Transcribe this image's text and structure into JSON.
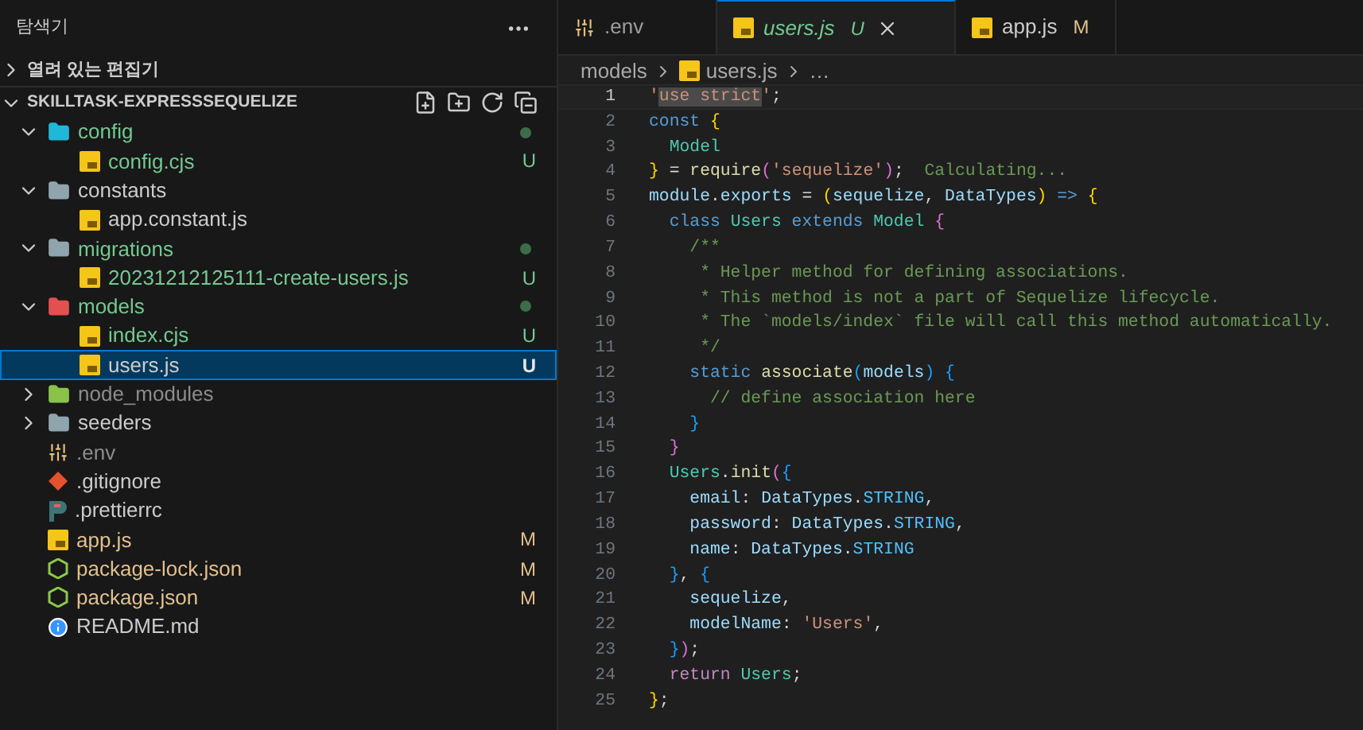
{
  "explorer": {
    "title": "탐색기",
    "open_editors": {
      "label": "열려 있는 편집기",
      "expanded": false
    },
    "project": {
      "label": "SKILLTASK-EXPRESSSEQUELIZE",
      "expanded": true
    },
    "tree": [
      {
        "name": "config",
        "kind": "folder-config",
        "expanded": true,
        "color": "#73c991",
        "dot": true,
        "children": [
          {
            "name": "config.cjs",
            "kind": "js",
            "color": "#73c991",
            "badge": "U",
            "selected": false
          }
        ]
      },
      {
        "name": "constants",
        "kind": "folder",
        "expanded": true,
        "children": [
          {
            "name": "app.constant.js",
            "kind": "js",
            "selected": false
          }
        ]
      },
      {
        "name": "migrations",
        "kind": "folder",
        "expanded": true,
        "color": "#73c991",
        "dot": true,
        "children": [
          {
            "name": "20231212125111-create-users.js",
            "kind": "js",
            "color": "#73c991",
            "badge": "U",
            "selected": false
          }
        ]
      },
      {
        "name": "models",
        "kind": "folder-models",
        "expanded": true,
        "color": "#73c991",
        "dot": true,
        "children": [
          {
            "name": "index.cjs",
            "kind": "js",
            "color": "#73c991",
            "badge": "U",
            "selected": false
          },
          {
            "name": "users.js",
            "kind": "js",
            "badge": "U",
            "selected": true
          }
        ]
      },
      {
        "name": "node_modules",
        "kind": "folder-node",
        "expanded": false,
        "color": "#8c8c8c"
      },
      {
        "name": "seeders",
        "kind": "folder",
        "expanded": false
      },
      {
        "name": ".env",
        "kind": "env",
        "color": "#8c8c8c",
        "selected": false
      },
      {
        "name": ".gitignore",
        "kind": "git",
        "selected": false
      },
      {
        "name": ".prettierrc",
        "kind": "prettier",
        "selected": false
      },
      {
        "name": "app.js",
        "kind": "js",
        "color": "#e2c08d",
        "badge": "M",
        "selected": false
      },
      {
        "name": "package-lock.json",
        "kind": "npm",
        "color": "#e2c08d",
        "badge": "M",
        "selected": false
      },
      {
        "name": "package.json",
        "kind": "npm",
        "color": "#e2c08d",
        "badge": "M",
        "selected": false
      },
      {
        "name": "README.md",
        "kind": "info",
        "selected": false
      }
    ]
  },
  "tabs": [
    {
      "label": ".env",
      "kind": "env",
      "selected": false,
      "color": "#9d9d9d"
    },
    {
      "label": "users.js",
      "kind": "js",
      "selected": true,
      "color": "#73c991",
      "badge": "U"
    },
    {
      "label": "app.js",
      "kind": "js",
      "selected": false,
      "color": "#e2c08d",
      "badge": "M"
    }
  ],
  "breadcrumb": [
    {
      "label": "models",
      "kind": "folder"
    },
    {
      "label": "users.js",
      "kind": "js"
    },
    {
      "label": "…",
      "kind": "more"
    }
  ],
  "code": [
    {
      "number": "1",
      "current": true,
      "tokens": [
        {
          "kind": "s",
          "text": "'"
        },
        {
          "kind": "sh",
          "text": "use strict"
        },
        {
          "kind": "s",
          "text": "'"
        },
        {
          "kind": "p",
          "text": ";"
        }
      ]
    },
    {
      "number": "2",
      "current": false,
      "tokens": [
        {
          "kind": "k",
          "text": "const "
        },
        {
          "kind": "b1",
          "text": "{"
        }
      ]
    },
    {
      "number": "3",
      "current": false,
      "tokens": [
        {
          "kind": "t",
          "text": "  Model"
        }
      ]
    },
    {
      "number": "4",
      "current": false,
      "tokens": [
        {
          "kind": "b1",
          "text": "}"
        },
        {
          "kind": "p",
          "text": " = "
        },
        {
          "kind": "f",
          "text": "require"
        },
        {
          "kind": "b2",
          "text": "("
        },
        {
          "kind": "s",
          "text": "'sequelize'"
        },
        {
          "kind": "b2",
          "text": ")"
        },
        {
          "kind": "p",
          "text": ";  "
        },
        {
          "kind": "g",
          "text": "Calculating..."
        }
      ]
    },
    {
      "number": "5",
      "current": false,
      "tokens": [
        {
          "kind": "v",
          "text": "module"
        },
        {
          "kind": "p",
          "text": "."
        },
        {
          "kind": "v",
          "text": "exports"
        },
        {
          "kind": "p",
          "text": " = "
        },
        {
          "kind": "b1",
          "text": "("
        },
        {
          "kind": "v",
          "text": "sequelize"
        },
        {
          "kind": "p",
          "text": ", "
        },
        {
          "kind": "v",
          "text": "DataTypes"
        },
        {
          "kind": "b1",
          "text": ")"
        },
        {
          "kind": "k",
          "text": " => "
        },
        {
          "kind": "b1",
          "text": "{"
        }
      ]
    },
    {
      "number": "6",
      "current": false,
      "tokens": [
        {
          "kind": "k",
          "text": "  class "
        },
        {
          "kind": "t",
          "text": "Users "
        },
        {
          "kind": "k",
          "text": "extends "
        },
        {
          "kind": "t",
          "text": "Model "
        },
        {
          "kind": "b2",
          "text": "{"
        }
      ]
    },
    {
      "number": "7",
      "current": false,
      "tokens": [
        {
          "kind": "m",
          "text": "    /**"
        }
      ]
    },
    {
      "number": "8",
      "current": false,
      "tokens": [
        {
          "kind": "m",
          "text": "     * Helper method for defining associations."
        }
      ]
    },
    {
      "number": "9",
      "current": false,
      "tokens": [
        {
          "kind": "m",
          "text": "     * This method is not a part of Sequelize lifecycle."
        }
      ]
    },
    {
      "number": "10",
      "current": false,
      "tokens": [
        {
          "kind": "m",
          "text": "     * The `models/index` file will call this method automatically."
        }
      ]
    },
    {
      "number": "11",
      "current": false,
      "tokens": [
        {
          "kind": "m",
          "text": "     */"
        }
      ]
    },
    {
      "number": "12",
      "current": false,
      "tokens": [
        {
          "kind": "k",
          "text": "    static "
        },
        {
          "kind": "f",
          "text": "associate"
        },
        {
          "kind": "b3",
          "text": "("
        },
        {
          "kind": "v",
          "text": "models"
        },
        {
          "kind": "b3",
          "text": ")"
        },
        {
          "kind": "b3",
          "text": " {"
        }
      ]
    },
    {
      "number": "13",
      "current": false,
      "tokens": [
        {
          "kind": "m",
          "text": "      // define association here"
        }
      ]
    },
    {
      "number": "14",
      "current": false,
      "tokens": [
        {
          "kind": "b3",
          "text": "    }"
        }
      ]
    },
    {
      "number": "15",
      "current": false,
      "tokens": [
        {
          "kind": "b2",
          "text": "  }"
        }
      ]
    },
    {
      "number": "16",
      "current": false,
      "tokens": [
        {
          "kind": "t",
          "text": "  Users"
        },
        {
          "kind": "p",
          "text": "."
        },
        {
          "kind": "f",
          "text": "init"
        },
        {
          "kind": "b2",
          "text": "("
        },
        {
          "kind": "b3",
          "text": "{"
        }
      ]
    },
    {
      "number": "17",
      "current": false,
      "tokens": [
        {
          "kind": "v",
          "text": "    email"
        },
        {
          "kind": "p",
          "text": ": "
        },
        {
          "kind": "v",
          "text": "DataTypes"
        },
        {
          "kind": "p",
          "text": "."
        },
        {
          "kind": "n",
          "text": "STRING"
        },
        {
          "kind": "p",
          "text": ","
        }
      ]
    },
    {
      "number": "18",
      "current": false,
      "tokens": [
        {
          "kind": "v",
          "text": "    password"
        },
        {
          "kind": "p",
          "text": ": "
        },
        {
          "kind": "v",
          "text": "DataTypes"
        },
        {
          "kind": "p",
          "text": "."
        },
        {
          "kind": "n",
          "text": "STRING"
        },
        {
          "kind": "p",
          "text": ","
        }
      ]
    },
    {
      "number": "19",
      "current": false,
      "tokens": [
        {
          "kind": "v",
          "text": "    name"
        },
        {
          "kind": "p",
          "text": ": "
        },
        {
          "kind": "v",
          "text": "DataTypes"
        },
        {
          "kind": "p",
          "text": "."
        },
        {
          "kind": "n",
          "text": "STRING"
        }
      ]
    },
    {
      "number": "20",
      "current": false,
      "tokens": [
        {
          "kind": "b3",
          "text": "  }"
        },
        {
          "kind": "p",
          "text": ", "
        },
        {
          "kind": "b3",
          "text": "{"
        }
      ]
    },
    {
      "number": "21",
      "current": false,
      "tokens": [
        {
          "kind": "v",
          "text": "    sequelize"
        },
        {
          "kind": "p",
          "text": ","
        }
      ]
    },
    {
      "number": "22",
      "current": false,
      "tokens": [
        {
          "kind": "v",
          "text": "    modelName"
        },
        {
          "kind": "p",
          "text": ": "
        },
        {
          "kind": "s",
          "text": "'Users'"
        },
        {
          "kind": "p",
          "text": ","
        }
      ]
    },
    {
      "number": "23",
      "current": false,
      "tokens": [
        {
          "kind": "b3",
          "text": "  }"
        },
        {
          "kind": "b2",
          "text": ")"
        },
        {
          "kind": "p",
          "text": ";"
        }
      ]
    },
    {
      "number": "24",
      "current": false,
      "tokens": [
        {
          "kind": "c",
          "text": "  return "
        },
        {
          "kind": "t",
          "text": "Users"
        },
        {
          "kind": "p",
          "text": ";"
        }
      ]
    },
    {
      "number": "25",
      "current": false,
      "tokens": [
        {
          "kind": "b1",
          "text": "}"
        },
        {
          "kind": "p",
          "text": ";"
        }
      ]
    }
  ]
}
